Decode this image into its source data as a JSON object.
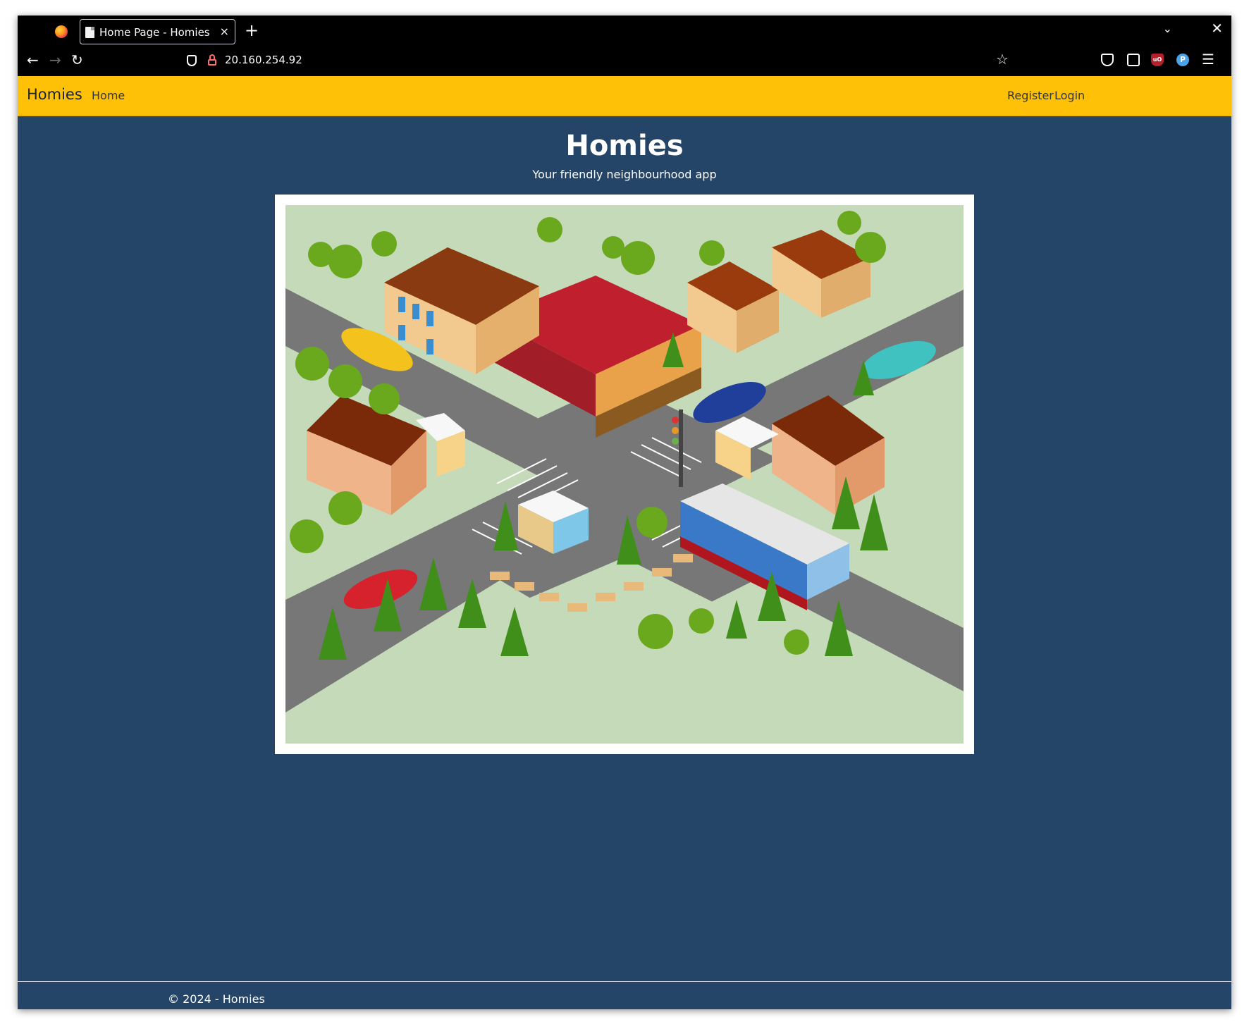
{
  "browser": {
    "tab_title": "Home Page - Homies",
    "tab_close": "×",
    "new_tab": "+",
    "url": "20.160.254.92",
    "icons": [
      "firefox-logo",
      "page-icon",
      "back-arrow-icon",
      "forward-arrow-icon",
      "reload-icon",
      "shield-icon",
      "lock-insecure-icon",
      "bookmark-star-icon",
      "pocket-icon",
      "extensions-icon",
      "ublock-icon",
      "proton-icon",
      "hamburger-menu-icon"
    ]
  },
  "navbar": {
    "brand": "Homies",
    "links": {
      "home": "Home",
      "register": "Register",
      "login": "Login"
    },
    "background": "#fec107"
  },
  "hero": {
    "title": "Homies",
    "subtitle": "Your friendly neighbourhood app"
  },
  "footer": {
    "text": "© 2024 - Homies"
  },
  "colors": {
    "page_background": "#244568",
    "brand_yellow": "#fec107"
  }
}
